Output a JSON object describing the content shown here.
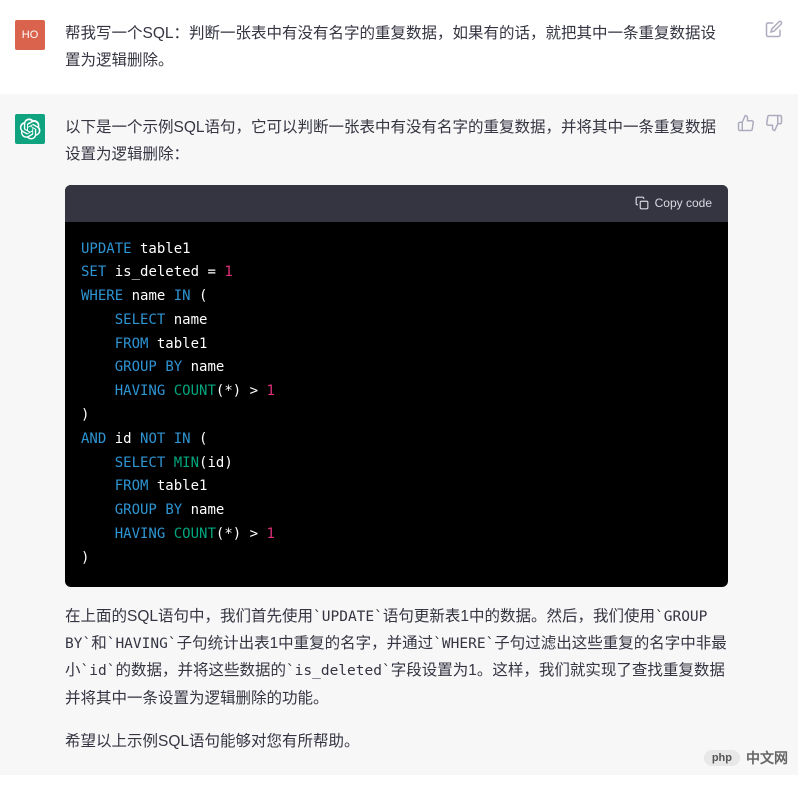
{
  "user": {
    "avatar_label": "HO",
    "message": "帮我写一个SQL：判断一张表中有没有名字的重复数据，如果有的话，就把其中一条重复数据设置为逻辑删除。"
  },
  "assistant": {
    "intro": "以下是一个示例SQL语句，它可以判断一张表中有没有名字的重复数据，并将其中一条重复数据设置为逻辑删除：",
    "explanation": "在上面的SQL语句中，我们首先使用`UPDATE`语句更新表1中的数据。然后，我们使用`GROUP BY`和`HAVING`子句统计出表1中重复的名字，并通过`WHERE`子句过滤出这些重复的名字中非最小`id`的数据，并将这些数据的`is_deleted`字段设置为1。这样，我们就实现了查找重复数据并将其中一条设置为逻辑删除的功能。",
    "closing": "希望以上示例SQL语句能够对您有所帮助。"
  },
  "code": {
    "copy_label": "Copy code",
    "tokens": [
      {
        "t": "UPDATE",
        "c": "kw-blue"
      },
      {
        "t": " table1\n",
        "c": "kw-white"
      },
      {
        "t": "SET",
        "c": "kw-blue"
      },
      {
        "t": " is_deleted ",
        "c": "kw-white"
      },
      {
        "t": "=",
        "c": "kw-white"
      },
      {
        "t": " ",
        "c": "kw-white"
      },
      {
        "t": "1",
        "c": "kw-red"
      },
      {
        "t": "\n",
        "c": "kw-white"
      },
      {
        "t": "WHERE",
        "c": "kw-blue"
      },
      {
        "t": " name ",
        "c": "kw-white"
      },
      {
        "t": "IN",
        "c": "kw-blue"
      },
      {
        "t": " (\n",
        "c": "kw-white"
      },
      {
        "t": "    ",
        "c": "kw-white"
      },
      {
        "t": "SELECT",
        "c": "kw-blue"
      },
      {
        "t": " name\n",
        "c": "kw-white"
      },
      {
        "t": "    ",
        "c": "kw-white"
      },
      {
        "t": "FROM",
        "c": "kw-blue"
      },
      {
        "t": " table1\n",
        "c": "kw-white"
      },
      {
        "t": "    ",
        "c": "kw-white"
      },
      {
        "t": "GROUP",
        "c": "kw-blue"
      },
      {
        "t": " ",
        "c": "kw-white"
      },
      {
        "t": "BY",
        "c": "kw-blue"
      },
      {
        "t": " name\n",
        "c": "kw-white"
      },
      {
        "t": "    ",
        "c": "kw-white"
      },
      {
        "t": "HAVING",
        "c": "kw-blue"
      },
      {
        "t": " ",
        "c": "kw-white"
      },
      {
        "t": "COUNT",
        "c": "kw-green"
      },
      {
        "t": "(",
        "c": "kw-white"
      },
      {
        "t": "*",
        "c": "kw-white"
      },
      {
        "t": ") ",
        "c": "kw-white"
      },
      {
        "t": ">",
        "c": "kw-white"
      },
      {
        "t": " ",
        "c": "kw-white"
      },
      {
        "t": "1",
        "c": "kw-red"
      },
      {
        "t": "\n",
        "c": "kw-white"
      },
      {
        "t": ")\n",
        "c": "kw-white"
      },
      {
        "t": "AND",
        "c": "kw-blue"
      },
      {
        "t": " id ",
        "c": "kw-white"
      },
      {
        "t": "NOT",
        "c": "kw-blue"
      },
      {
        "t": " ",
        "c": "kw-white"
      },
      {
        "t": "IN",
        "c": "kw-blue"
      },
      {
        "t": " (\n",
        "c": "kw-white"
      },
      {
        "t": "    ",
        "c": "kw-white"
      },
      {
        "t": "SELECT",
        "c": "kw-blue"
      },
      {
        "t": " ",
        "c": "kw-white"
      },
      {
        "t": "MIN",
        "c": "kw-green"
      },
      {
        "t": "(id)\n",
        "c": "kw-white"
      },
      {
        "t": "    ",
        "c": "kw-white"
      },
      {
        "t": "FROM",
        "c": "kw-blue"
      },
      {
        "t": " table1\n",
        "c": "kw-white"
      },
      {
        "t": "    ",
        "c": "kw-white"
      },
      {
        "t": "GROUP",
        "c": "kw-blue"
      },
      {
        "t": " ",
        "c": "kw-white"
      },
      {
        "t": "BY",
        "c": "kw-blue"
      },
      {
        "t": " name\n",
        "c": "kw-white"
      },
      {
        "t": "    ",
        "c": "kw-white"
      },
      {
        "t": "HAVING",
        "c": "kw-blue"
      },
      {
        "t": " ",
        "c": "kw-white"
      },
      {
        "t": "COUNT",
        "c": "kw-green"
      },
      {
        "t": "(",
        "c": "kw-white"
      },
      {
        "t": "*",
        "c": "kw-white"
      },
      {
        "t": ") ",
        "c": "kw-white"
      },
      {
        "t": ">",
        "c": "kw-white"
      },
      {
        "t": " ",
        "c": "kw-white"
      },
      {
        "t": "1",
        "c": "kw-red"
      },
      {
        "t": "\n",
        "c": "kw-white"
      },
      {
        "t": ")",
        "c": "kw-white"
      }
    ]
  },
  "watermark": {
    "badge": "php",
    "text": "中文网"
  }
}
